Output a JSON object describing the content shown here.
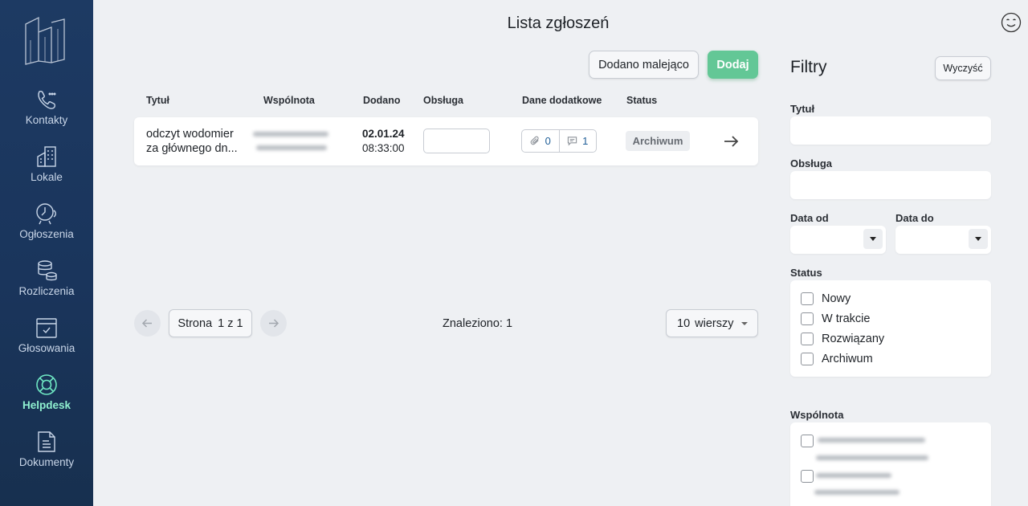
{
  "sidebar": {
    "items": [
      {
        "label": "Kontakty",
        "icon": "phone-icon"
      },
      {
        "label": "Lokale",
        "icon": "building-icon"
      },
      {
        "label": "Ogłoszenia",
        "icon": "bell-icon"
      },
      {
        "label": "Rozliczenia",
        "icon": "coins-icon"
      },
      {
        "label": "Głosowania",
        "icon": "ballot-icon"
      },
      {
        "label": "Helpdesk",
        "icon": "lifebuoy-icon",
        "active": true
      },
      {
        "label": "Dokumenty",
        "icon": "document-icon"
      }
    ]
  },
  "header": {
    "title": "Lista zgłoszeń"
  },
  "toolbar": {
    "sort_label": "Dodano malejąco",
    "add_label": "Dodaj"
  },
  "table": {
    "columns": [
      "Tytuł",
      "Wspólnota",
      "Dodano",
      "Obsługa",
      "Dane dodatkowe",
      "Status"
    ],
    "rows": [
      {
        "title_line1": "odczyt wodomier",
        "title_line2": "za głównego dn...",
        "date": "02.01.24",
        "time": "08:33:00",
        "attachments": "0",
        "comments": "1",
        "status": "Archiwum"
      }
    ]
  },
  "pagination": {
    "page_word": "Strona",
    "page_info": "1 z 1",
    "found": "Znaleziono: 1",
    "rows_count": "10",
    "rows_word": "wierszy"
  },
  "filters": {
    "title": "Filtry",
    "clear_label": "Wyczyść",
    "title_label": "Tytuł",
    "service_label": "Obsługa",
    "date_from_label": "Data od",
    "date_to_label": "Data do",
    "status_label": "Status",
    "statuses": [
      "Nowy",
      "W trakcie",
      "Rozwiązany",
      "Archiwum"
    ],
    "community_label": "Wspólnota"
  },
  "colors": {
    "sidebar_bg": "#1d3a63",
    "accent_green": "#63c796",
    "active_nav": "#6ee7c3",
    "link_blue": "#1f5e97"
  }
}
